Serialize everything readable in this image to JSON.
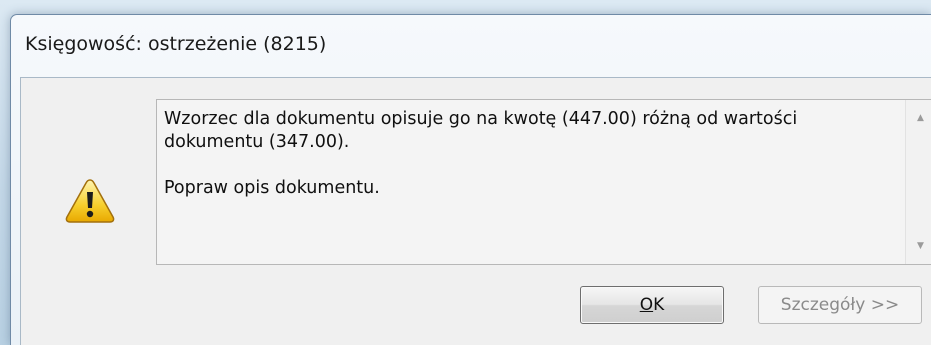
{
  "dialog": {
    "title": "Księgowość: ostrzeżenie (8215)",
    "icon": "warning-icon",
    "message": {
      "line1": "Wzorzec  dla dokumentu opisuje go na kwotę (447.00) różną od wartości",
      "line2": "dokumentu (347.00).",
      "line3": "Popraw opis dokumentu."
    },
    "buttons": {
      "ok_accel": "O",
      "ok_rest": "K",
      "details": "Szczegóły >>"
    },
    "scrollbar": {
      "up_glyph": "▲",
      "down_glyph": "▼"
    }
  }
}
